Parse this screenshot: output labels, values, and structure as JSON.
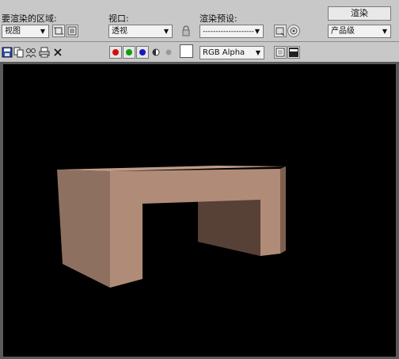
{
  "top": {
    "area_label": "要渲染的区域:",
    "area_value": "视图",
    "viewport_label": "视口:",
    "viewport_value": "透视",
    "preset_label": "渲染预设:",
    "preset_value": "--------------------",
    "render_button": "渲染",
    "quality_value": "产品级"
  },
  "toolbar": {
    "channel_value": "RGB Alpha",
    "colors": {
      "red": "#d01010",
      "green": "#10a010",
      "blue": "#1818c8",
      "swatch": "#ffffff",
      "viewport_bg": "#000000",
      "object_front": "#b08c78",
      "object_side": "#5c4438"
    }
  },
  "icons": [
    "crop-icon",
    "region-icon",
    "lock-icon",
    "preset-load-icon",
    "preset-save-icon",
    "save-image-icon",
    "copy-image-icon",
    "clone-window-icon",
    "print-icon",
    "clear-icon",
    "red-channel-icon",
    "green-channel-icon",
    "blue-channel-icon",
    "mono-icon",
    "alpha-icon",
    "swatch-icon",
    "display-alpha-icon",
    "display-rgb-icon"
  ]
}
